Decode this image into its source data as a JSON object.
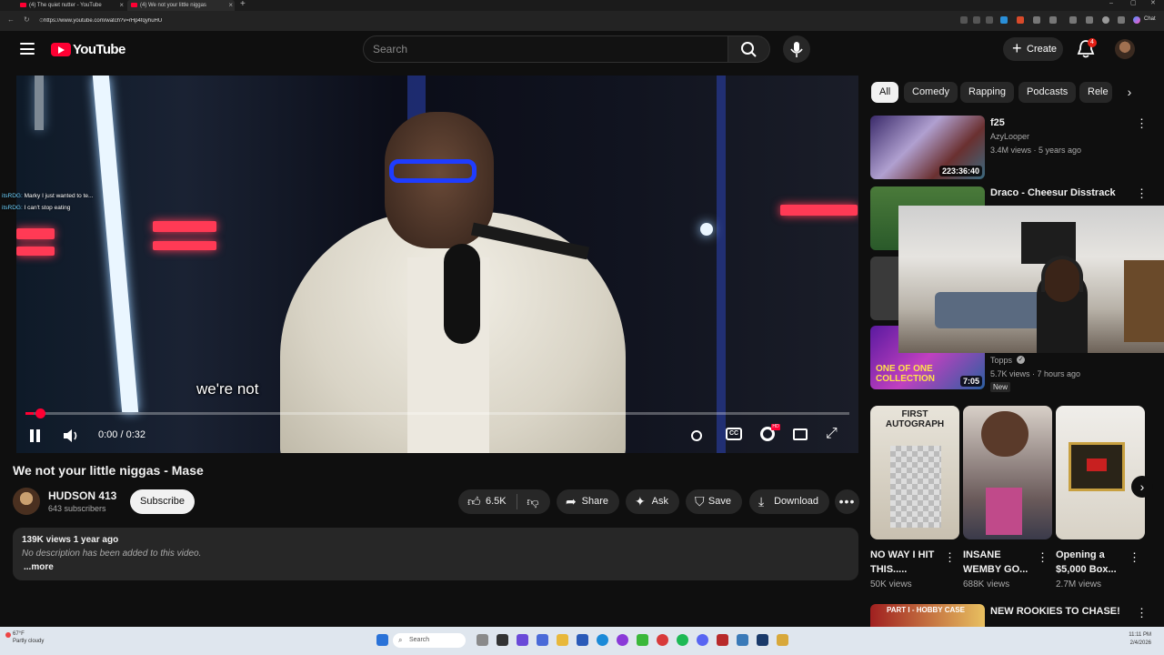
{
  "browser": {
    "tabs": [
      {
        "title": "(4) The quiet nutter - YouTube"
      },
      {
        "title": "(4) We not your little niggas"
      }
    ],
    "url": "https://www.youtube.com/watch?v=rHp4fqyhuHU",
    "chat_label": "Chat"
  },
  "header": {
    "logo_text": "YouTube",
    "search_placeholder": "Search",
    "create_label": "Create",
    "notification_count": "4"
  },
  "player": {
    "subtitle": "we're not",
    "time": "0:00 / 0:32",
    "progress": 0.01,
    "chat": [
      {
        "user": "itsRDG:",
        "message": "Marky I just wanted to te..."
      },
      {
        "user": "itsRDG:",
        "message": "I can't stop eating"
      }
    ]
  },
  "video": {
    "title": "We not your little niggas - Mase",
    "channel": "HUDSON 413",
    "subscribers": "643 subscribers",
    "subscribe_label": "Subscribe",
    "likes": "6.5K",
    "share_label": "Share",
    "ask_label": "Ask",
    "save_label": "Save",
    "download_label": "Download",
    "views_date": "139K views  1 year ago",
    "description": "No description has been added to this video.",
    "more_label": "...more"
  },
  "chips": [
    "All",
    "Comedy",
    "Rapping",
    "Podcasts",
    "Rele"
  ],
  "recommendations": [
    {
      "title": "f25",
      "channel": "AzyLooper",
      "meta": "3.4M views · 5 years ago",
      "duration": "223:36:40"
    },
    {
      "title": "Draco - Cheesur Disstrack",
      "channel": "",
      "meta": "",
      "duration": ""
    },
    {
      "title": "",
      "channel": "Topps",
      "meta": "5.7K views · 7 hours ago",
      "duration": "7:05",
      "badge": "New",
      "thumb_text": "ONE OF ONE COLLECTION"
    }
  ],
  "shorts": [
    {
      "title": "NO WAY I HIT THIS.....",
      "views": "50K views",
      "thumb_text": "FIRST AUTOGRAPH"
    },
    {
      "title": "INSANE WEMBY GO...",
      "views": "688K views"
    },
    {
      "title": "Opening a $5,000 Box...",
      "views": "2.7M views"
    }
  ],
  "next_rec": {
    "title": "NEW ROOKIES TO CHASE!",
    "thumb_text": "PART I - HOBBY CASE"
  },
  "taskbar": {
    "weather": "67°F\nPartly cloudy",
    "search": "Search",
    "time": "11:11 PM",
    "date": "2/4/2026"
  }
}
